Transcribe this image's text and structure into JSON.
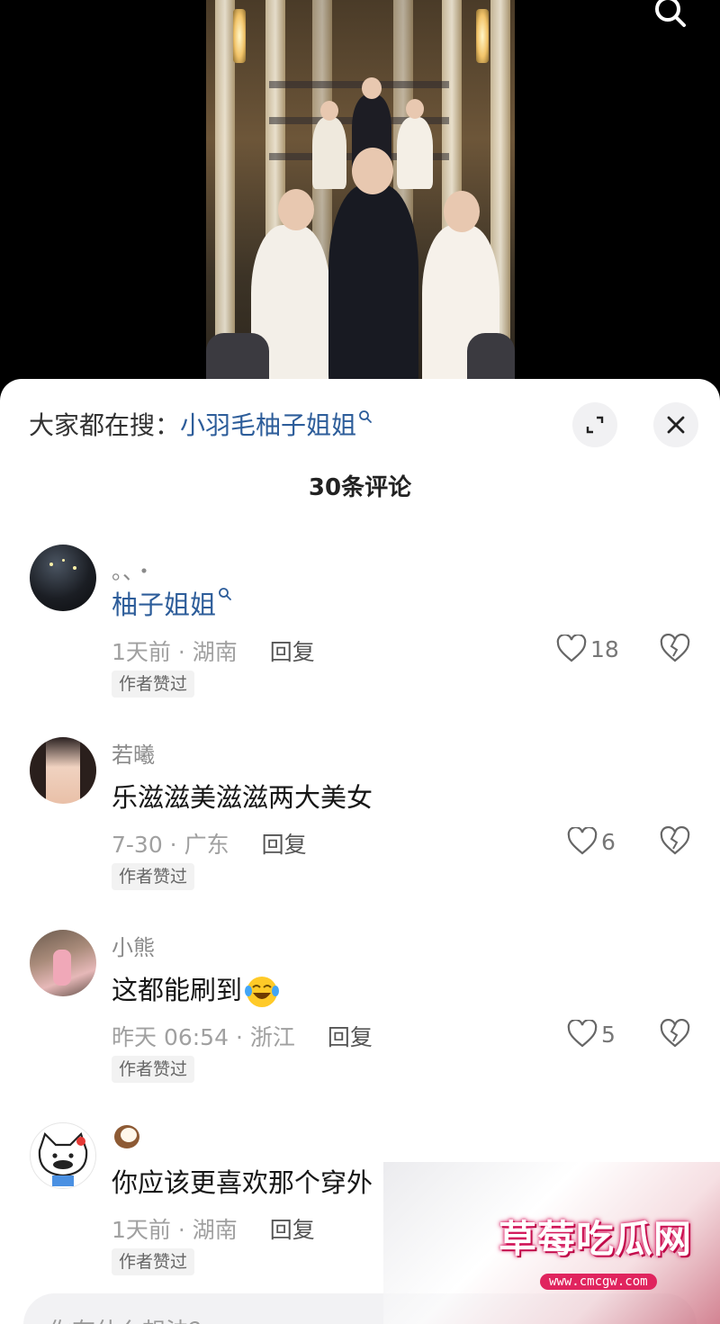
{
  "hot_search": {
    "label": "大家都在搜：",
    "term": "小羽毛柚子姐姐"
  },
  "comment_count": "30条评论",
  "comments": [
    {
      "user": "。、・",
      "text": "柚子姐姐",
      "time": "1天前 · 湖南",
      "reply": "回复",
      "likes": "18",
      "badge": "作者赞过"
    },
    {
      "user": "若曦",
      "text": "乐滋滋美滋滋两大美女",
      "time": "7-30 · 广东",
      "reply": "回复",
      "likes": "6",
      "badge": "作者赞过"
    },
    {
      "user": "小熊",
      "text": "这都能刷到",
      "time": "昨天 06:54 · 浙江",
      "reply": "回复",
      "likes": "5",
      "badge": "作者赞过"
    },
    {
      "user": "",
      "text": "你应该更喜欢那个穿外",
      "time": "1天前 · 湖南",
      "reply": "回复",
      "likes": "",
      "badge": "作者赞过"
    }
  ],
  "input": {
    "placeholder": "你有什么想法？"
  },
  "watermark": {
    "main": "草莓吃瓜网",
    "url": "www.cmcgw.com"
  },
  "colors": {
    "link": "#2d5d9a",
    "watermark": "#e0245e"
  }
}
